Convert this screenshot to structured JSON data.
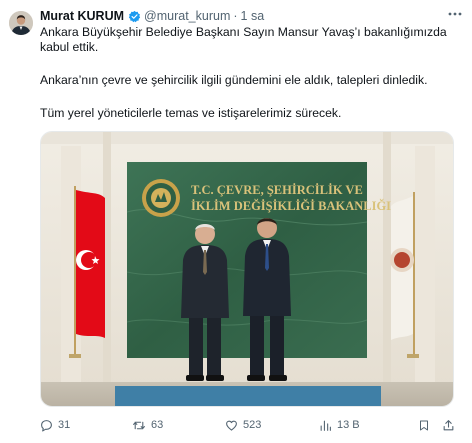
{
  "tweet": {
    "author_name": "Murat KURUM",
    "handle": "@murat_kurum",
    "separator": "·",
    "time": "1 sa",
    "paragraphs": [
      "Ankara Büyükşehir Belediye Başkanı Sayın Mansur Yavaş’ı bakanlığımızda kabul ettik.",
      "Ankara’nın çevre ve şehircilik ilgili gündemini ele aldık, talepleri dinledik.",
      "Tüm yerel yöneticilerle temas ve istişarelerimiz sürecek."
    ],
    "photo": {
      "sign_line1": "T.C. ÇEVRE, ŞEHİRCİLİK VE",
      "sign_line2": "İKLİM DEĞİŞİKLİĞİ BAKANLIĞI"
    },
    "actions": {
      "replies": "31",
      "retweets": "63",
      "likes": "523",
      "views": "13 B"
    }
  },
  "colors": {
    "text": "#0f1419",
    "secondary": "#536471",
    "verified": "#1d9bf0",
    "sign_green": "#2f5f44",
    "flag_red": "#e30a17"
  },
  "icons": [
    "verified-badge-icon",
    "more-icon",
    "reply-icon",
    "retweet-icon",
    "like-icon",
    "views-icon",
    "bookmark-icon",
    "share-icon"
  ]
}
